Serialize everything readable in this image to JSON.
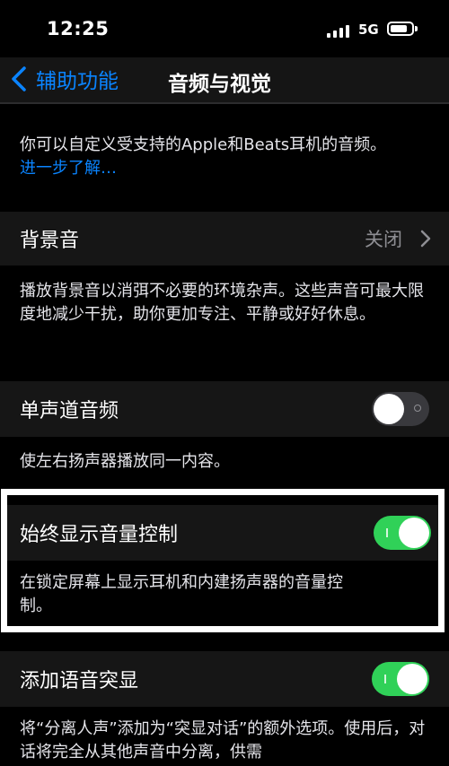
{
  "status_bar": {
    "time": "12:25",
    "network": "5G",
    "icons": [
      "signal-icon",
      "battery-icon"
    ]
  },
  "nav": {
    "back_label": "辅助功能",
    "title": "音频与视觉",
    "back_icon": "chevron-left-icon"
  },
  "intro": {
    "text": "你可以自定义受支持的Apple和Beats耳机的音频。",
    "link": "进一步了解…"
  },
  "background_sounds": {
    "label": "背景音",
    "value": "关闭",
    "description": "播放背景音以消弭不必要的环境杂声。这些声音可最大限度地减少干扰，助你更加专注、平静或好好休息。"
  },
  "mono_audio": {
    "label": "单声道音频",
    "state": "off",
    "description": "使左右扬声器播放同一内容。"
  },
  "always_show_volume": {
    "label": "始终显示音量控制",
    "state": "on",
    "description": "在锁定屏幕上显示耳机和内建扬声器的音量控制。"
  },
  "voice_isolation": {
    "label": "添加语音突显",
    "state": "on",
    "description": "将“分离人声”添加为“突显对话”的额外选项。使用后，对话将完全从其他声音中分离，供需"
  },
  "colors": {
    "accent": "#0a84ff",
    "toggle_on": "#30d158",
    "toggle_off": "#39393d",
    "cell_bg": "#161616"
  }
}
